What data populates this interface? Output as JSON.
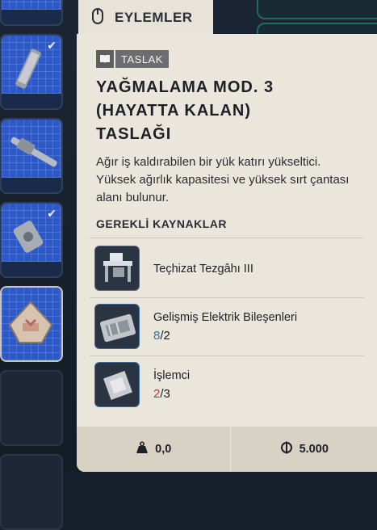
{
  "tab": {
    "label": "EYLEMLER",
    "icon": "mouse-icon"
  },
  "badge": {
    "icon": "book-icon",
    "label": "TASLAK"
  },
  "title_lines": [
    "YAĞMALAMA MOD. 3",
    "(HAYATTA KALAN)",
    "TASLAĞI"
  ],
  "description": "Ağır iş kaldırabilen bir yük katırı yükseltici. Yüksek ağırlık kapasitesi ve yüksek sırt çantası alanı bulunur.",
  "requirements": {
    "heading": "GEREKLİ KAYNAKLAR",
    "items": [
      {
        "name": "Teçhizat Tezgâhı III",
        "icon": "workbench-icon"
      },
      {
        "name": "Gelişmiş Elektrik Bileşenleri",
        "have": "8",
        "need": "2",
        "icon": "electrical-components-icon"
      },
      {
        "name": "İşlemci",
        "have": "2",
        "need": "3",
        "icon": "processor-icon"
      }
    ]
  },
  "footer": {
    "weight": {
      "icon": "weight-icon",
      "value": "0,0"
    },
    "price": {
      "icon": "currency-icon",
      "value": "5.000"
    }
  },
  "colors": {
    "have_ok": "#3a6e9a",
    "have_low": "#b43a32",
    "panel_bg": "#ebe6dc",
    "slot_blue": "#2e58c4"
  }
}
